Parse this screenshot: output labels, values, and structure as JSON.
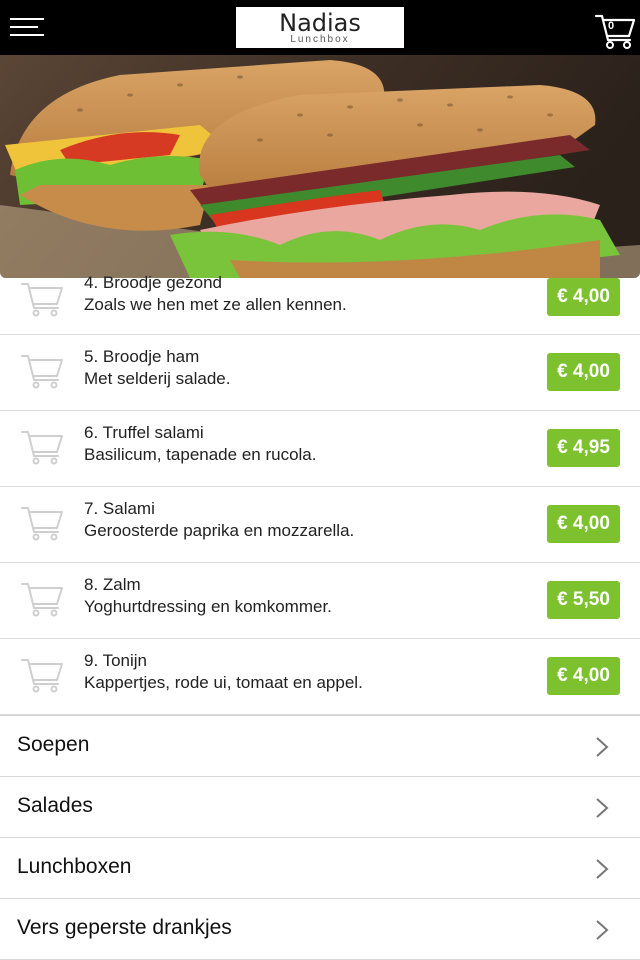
{
  "header": {
    "menu_icon": "hamburger-menu-icon",
    "brand_name": "Nadias",
    "brand_sub": "Lunchbox",
    "cart_icon": "shopping-cart-icon",
    "cart_count": "0"
  },
  "products": [
    {
      "title": "4. Broodje gezond",
      "description": "Zoals we hen met ze allen kennen.",
      "price": "€ 4,00"
    },
    {
      "title": "5. Broodje ham",
      "description": "Met selderij salade.",
      "price": "€ 4,00"
    },
    {
      "title": "6. Truffel salami",
      "description": "Basilicum, tapenade en rucola.",
      "price": "€ 4,95"
    },
    {
      "title": "7. Salami",
      "description": "Geroosterde paprika en mozzarella.",
      "price": "€ 4,00"
    },
    {
      "title": "8. Zalm",
      "description": "Yoghurtdressing en komkommer.",
      "price": "€ 5,50"
    },
    {
      "title": "9. Tonijn",
      "description": "Kappertjes, rode ui, tomaat en appel.",
      "price": "€ 4,00"
    }
  ],
  "categories": [
    {
      "label": "Soepen"
    },
    {
      "label": "Salades"
    },
    {
      "label": "Lunchboxen"
    },
    {
      "label": "Vers geperste drankjes"
    }
  ],
  "colors": {
    "topbar": "#000000",
    "price_button": "#7dc22e",
    "cart_icon_gray": "#cfcfcf",
    "divider": "#dcdcdc"
  }
}
